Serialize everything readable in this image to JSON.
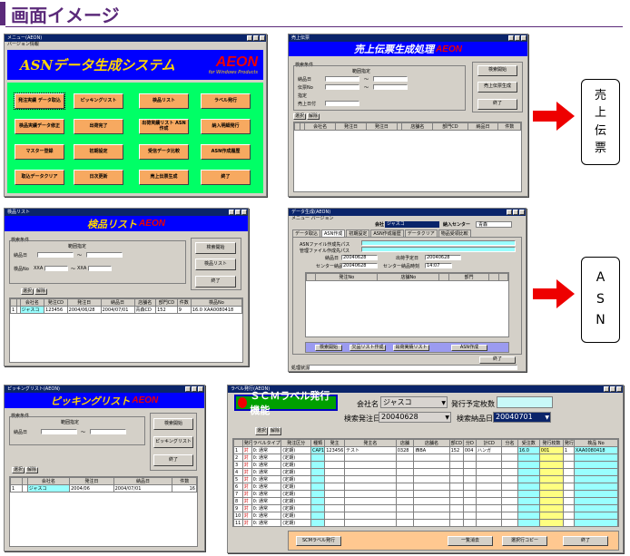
{
  "header": {
    "title": "画面イメージ",
    "accent": "#5b2a7a"
  },
  "asn_menu": {
    "title": "メニュー(AEON)",
    "menu": "バージョン情報",
    "banner": "ASNデータ生成システム",
    "brand": "AEON",
    "brand_sub": "for Windows Products",
    "buttons": [
      "発注実績 データ取込",
      "ピッキングリスト",
      "検品リスト",
      "ラベル発行",
      "検品実績データ修正",
      "出荷完了",
      "出荷実績リスト ASN作成",
      "納入明細発行",
      "マスター登録",
      "初期設定",
      "受信データ比較",
      "ASN作成履歴",
      "取込データクリア",
      "日次更新",
      "売上伝票生成",
      "終了"
    ]
  },
  "sales_slip": {
    "title": "売上伝票",
    "banner": "売上伝票生成処理",
    "brand": "AEON",
    "group": "検索条件",
    "range": "範囲指定",
    "labels": [
      "納品日",
      "伝票No",
      "指定",
      "売上日付"
    ],
    "tilde": "〜",
    "buttons": [
      "検索開始",
      "売上伝票生成",
      "終了"
    ],
    "sel_buttons": [
      "選択",
      "解除"
    ],
    "columns": [
      "",
      "",
      "会社名",
      "発注日",
      "発注日",
      "",
      "店舗名",
      "部門CD",
      "納品日",
      "件数"
    ]
  },
  "inspect_list": {
    "title": "検品リスト",
    "banner": "検品リスト",
    "brand": "AEON",
    "group": "検索条件",
    "range": "範囲指定",
    "labels": [
      "納品日",
      "検品No"
    ],
    "prefix": "XXA",
    "tilde": "〜",
    "buttons": [
      "検索開始",
      "検品リスト",
      "終了"
    ],
    "sel_buttons": [
      "選択",
      "解除"
    ],
    "columns": [
      "",
      "",
      "会社名",
      "発注CD",
      "発注日",
      "納品日",
      "店舗名",
      "部門CD",
      "件数",
      "検品No"
    ],
    "row": [
      "1",
      "",
      "ジャスコ",
      "123456",
      "2004/06/28",
      "2004/07/01",
      "青森CD",
      "152",
      "9",
      "16.0  XAA0080418"
    ]
  },
  "asn_create": {
    "title": "データ生成(AEON)",
    "menu": "メニュー  バージョン",
    "company_label": "会社",
    "company": "ジャスコ",
    "center_label": "納入センター",
    "center": "青森",
    "tabs": [
      "データ取込",
      "ASN作成",
      "初期設定",
      "ASN作成履歴",
      "データクリア",
      "物品受領比較"
    ],
    "fields": [
      "ASNファイル作成先パス",
      "管理ファイル作成先パス",
      "納品日",
      "出荷予定日",
      "センター納品日",
      "センター納品時刻"
    ],
    "values": [
      "20040628",
      "20040628",
      "20040628",
      "14:07"
    ],
    "columns": [
      "",
      "発注No",
      "店舗No",
      "",
      "部門",
      "",
      ""
    ],
    "buttons": [
      "検索開始",
      "欠品リスト作成",
      "出荷実績リスト",
      "ASN作成",
      "終了"
    ],
    "status": "処理状況"
  },
  "picking": {
    "title": "ピッキングリスト(AEON)",
    "banner": "ピッキングリスト",
    "brand": "AEON",
    "group": "検索条件",
    "range": "範囲指定",
    "labels": [
      "納品日"
    ],
    "tilde": "〜",
    "buttons": [
      "検索開始",
      "ピッキングリスト",
      "終了"
    ],
    "sel_buttons": [
      "選択",
      "解除"
    ],
    "columns": [
      "",
      "",
      "会社名",
      "発注日",
      "納品日",
      "件数"
    ],
    "row": [
      "1",
      "",
      "ジャスコ",
      "2004/06",
      "2004/07/01",
      "16"
    ]
  },
  "scm": {
    "title": "ラベル発行(AEON)",
    "banner": "ＳＣＭラベル発行機能",
    "company_label": "会社名",
    "company": "ジャスコ",
    "planned_label": "発行予定枚数",
    "date_label": "検索発注日",
    "date": "20040628",
    "deliv_label": "検索納品日",
    "deliv": "20040701",
    "sel_buttons": [
      "選択",
      "解除"
    ],
    "columns": [
      "",
      "発行",
      "ラベルタイプ",
      "発注区分",
      "種類",
      "発主",
      "発主名",
      "店舗",
      "店舗名",
      "部CD",
      "分D",
      "計CD",
      "分名",
      "受注数",
      "発行枚数",
      "発行枚数",
      "検品 No"
    ],
    "row": [
      "1",
      "対",
      "0: 通常",
      "(定期)",
      "CAP1S",
      "123456",
      "テスト",
      "0328",
      "西BA",
      "152",
      "004",
      "ハンガ",
      "",
      "16.0",
      "001",
      "1",
      "XAA0080418"
    ],
    "blank_row": [
      "対",
      "0: 通常",
      "(定期)"
    ],
    "row_count": 13,
    "buttons": [
      "SCMラベル発行",
      "一覧消去",
      "選択行コピー",
      "終了"
    ]
  },
  "callouts": {
    "slip": [
      "売",
      "上",
      "伝",
      "票"
    ],
    "asn": [
      "A",
      "S",
      "N"
    ]
  }
}
